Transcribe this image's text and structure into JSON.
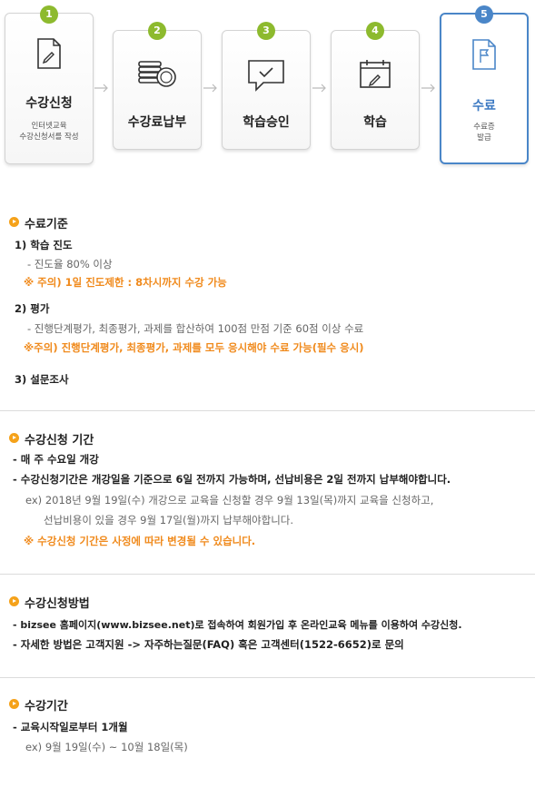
{
  "steps": [
    {
      "num": "1",
      "title": "수강신청",
      "sub1": "인터넷교육",
      "sub2": "수강신청서를 작성",
      "icon": "document-pencil-icon"
    },
    {
      "num": "2",
      "title": "수강료납부",
      "icon": "coins-icon"
    },
    {
      "num": "3",
      "title": "학습승인",
      "icon": "chat-check-icon"
    },
    {
      "num": "4",
      "title": "학습",
      "icon": "calendar-pencil-icon"
    },
    {
      "num": "5",
      "title": "수료",
      "sub1": "수료증",
      "sub2": "발급",
      "icon": "flag-document-icon"
    }
  ],
  "criteria": {
    "heading": "수료기준",
    "item1_title": "1) 학습 진도",
    "item1_line1": "- 진도율 80% 이상",
    "item1_note": "※ 주의) 1일 진도제한 : 8차시까지 수강 가능",
    "item2_title": "2) 평가",
    "item2_line1": "- 진행단계평가, 최종평가, 과제를 합산하여 100점 만점 기준 60점 이상 수료",
    "item2_note": "※주의) 진행단계평가, 최종평가, 과제를 모두 응시해야 수료 가능(필수 응시)",
    "item3_title": "3) 설문조사"
  },
  "period": {
    "heading": "수강신청 기간",
    "line1": "- 매 주 수요일 개강",
    "line2": "- 수강신청기간은 개강일을 기준으로 6일 전까지 가능하며, 선납비용은 2일 전까지 납부해야합니다.",
    "ex1": "ex) 2018년 9월 19일(수) 개강으로 교육을 신청할 경우 9월 13일(목)까지 교육을 신청하고,",
    "ex2": "선납비용이 있을 경우 9월 17일(월)까지 납부해야합니다.",
    "note": "※ 수강신청 기간은 사정에 따라 변경될 수 있습니다."
  },
  "method": {
    "heading": "수강신청방법",
    "line1": "- bizsee 홈페이지(www.bizsee.net)로 접속하여 회원가입 후 온라인교육 메뉴를 이용하여 수강신청.",
    "line2": "- 자세한 방법은 고객지원 -> 자주하는질문(FAQ) 혹은 고객센터(1522-6652)로 문의"
  },
  "duration": {
    "heading": "수강기간",
    "line1": "- 교육시작일로부터 1개월",
    "ex": "ex) 9월 19일(수) ~ 10월 18일(목)"
  },
  "colors": {
    "accent_green": "#8dba2e",
    "accent_blue": "#4a86c8",
    "accent_orange": "#f08a1c",
    "bullet": "#f5a21a"
  }
}
